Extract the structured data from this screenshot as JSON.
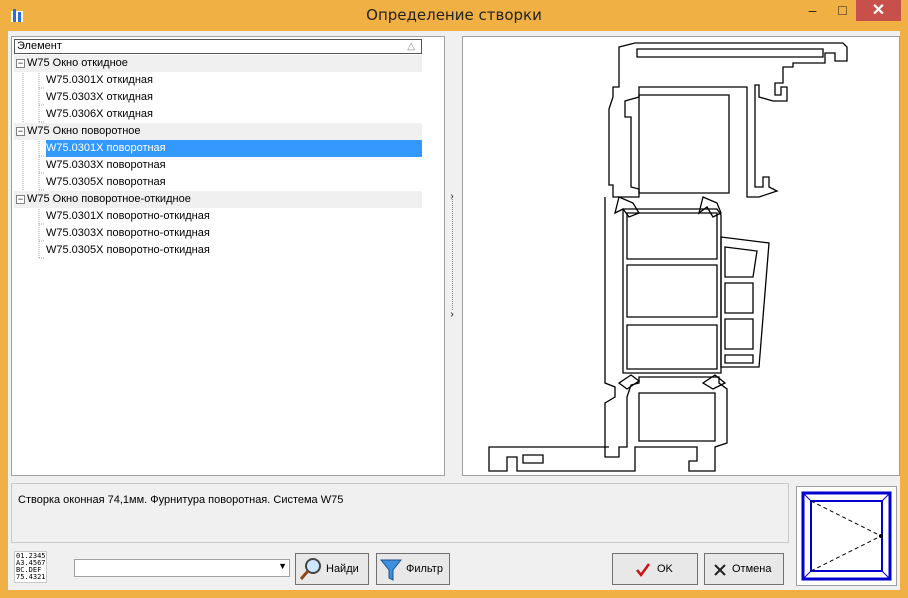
{
  "window": {
    "title": "Определение створки"
  },
  "titlebar": {
    "minimize": "–",
    "maximize": "□",
    "close": "✕"
  },
  "tree": {
    "column_header": "Элемент",
    "groups": [
      {
        "label": "W75 Окно откидное",
        "expander": "−",
        "items": [
          "W75.0301X откидная",
          "W75.0303X откидная",
          "W75.0306X откидная"
        ]
      },
      {
        "label": "W75 Окно поворотное",
        "expander": "−",
        "items": [
          "W75.0301X поворотная",
          "W75.0303X поворотная",
          "W75.0305X поворотная"
        ]
      },
      {
        "label": "W75 Окно поворотное-откидное",
        "expander": "−",
        "items": [
          "W75.0301X поворотно-откидная",
          "W75.0303X поворотно-откидная",
          "W75.0305X поворотно-откидная"
        ]
      }
    ],
    "selected": "W75.0301X поворотная"
  },
  "description": {
    "text": "Створка оконная 74,1мм. Фурнитура поворотная. Система W75"
  },
  "code_icon": {
    "lines": [
      "01.2345",
      "A3.4567",
      "BC.DEF",
      "75.4321"
    ]
  },
  "search": {
    "value": ""
  },
  "buttons": {
    "find": "Найди",
    "filter": "Фильтр",
    "ok": "OK",
    "cancel": "Отмена"
  },
  "colors": {
    "titlebar": "#f0b043",
    "selection": "#3399ff",
    "close": "#c7504a",
    "frame_blue": "#0000cc"
  }
}
